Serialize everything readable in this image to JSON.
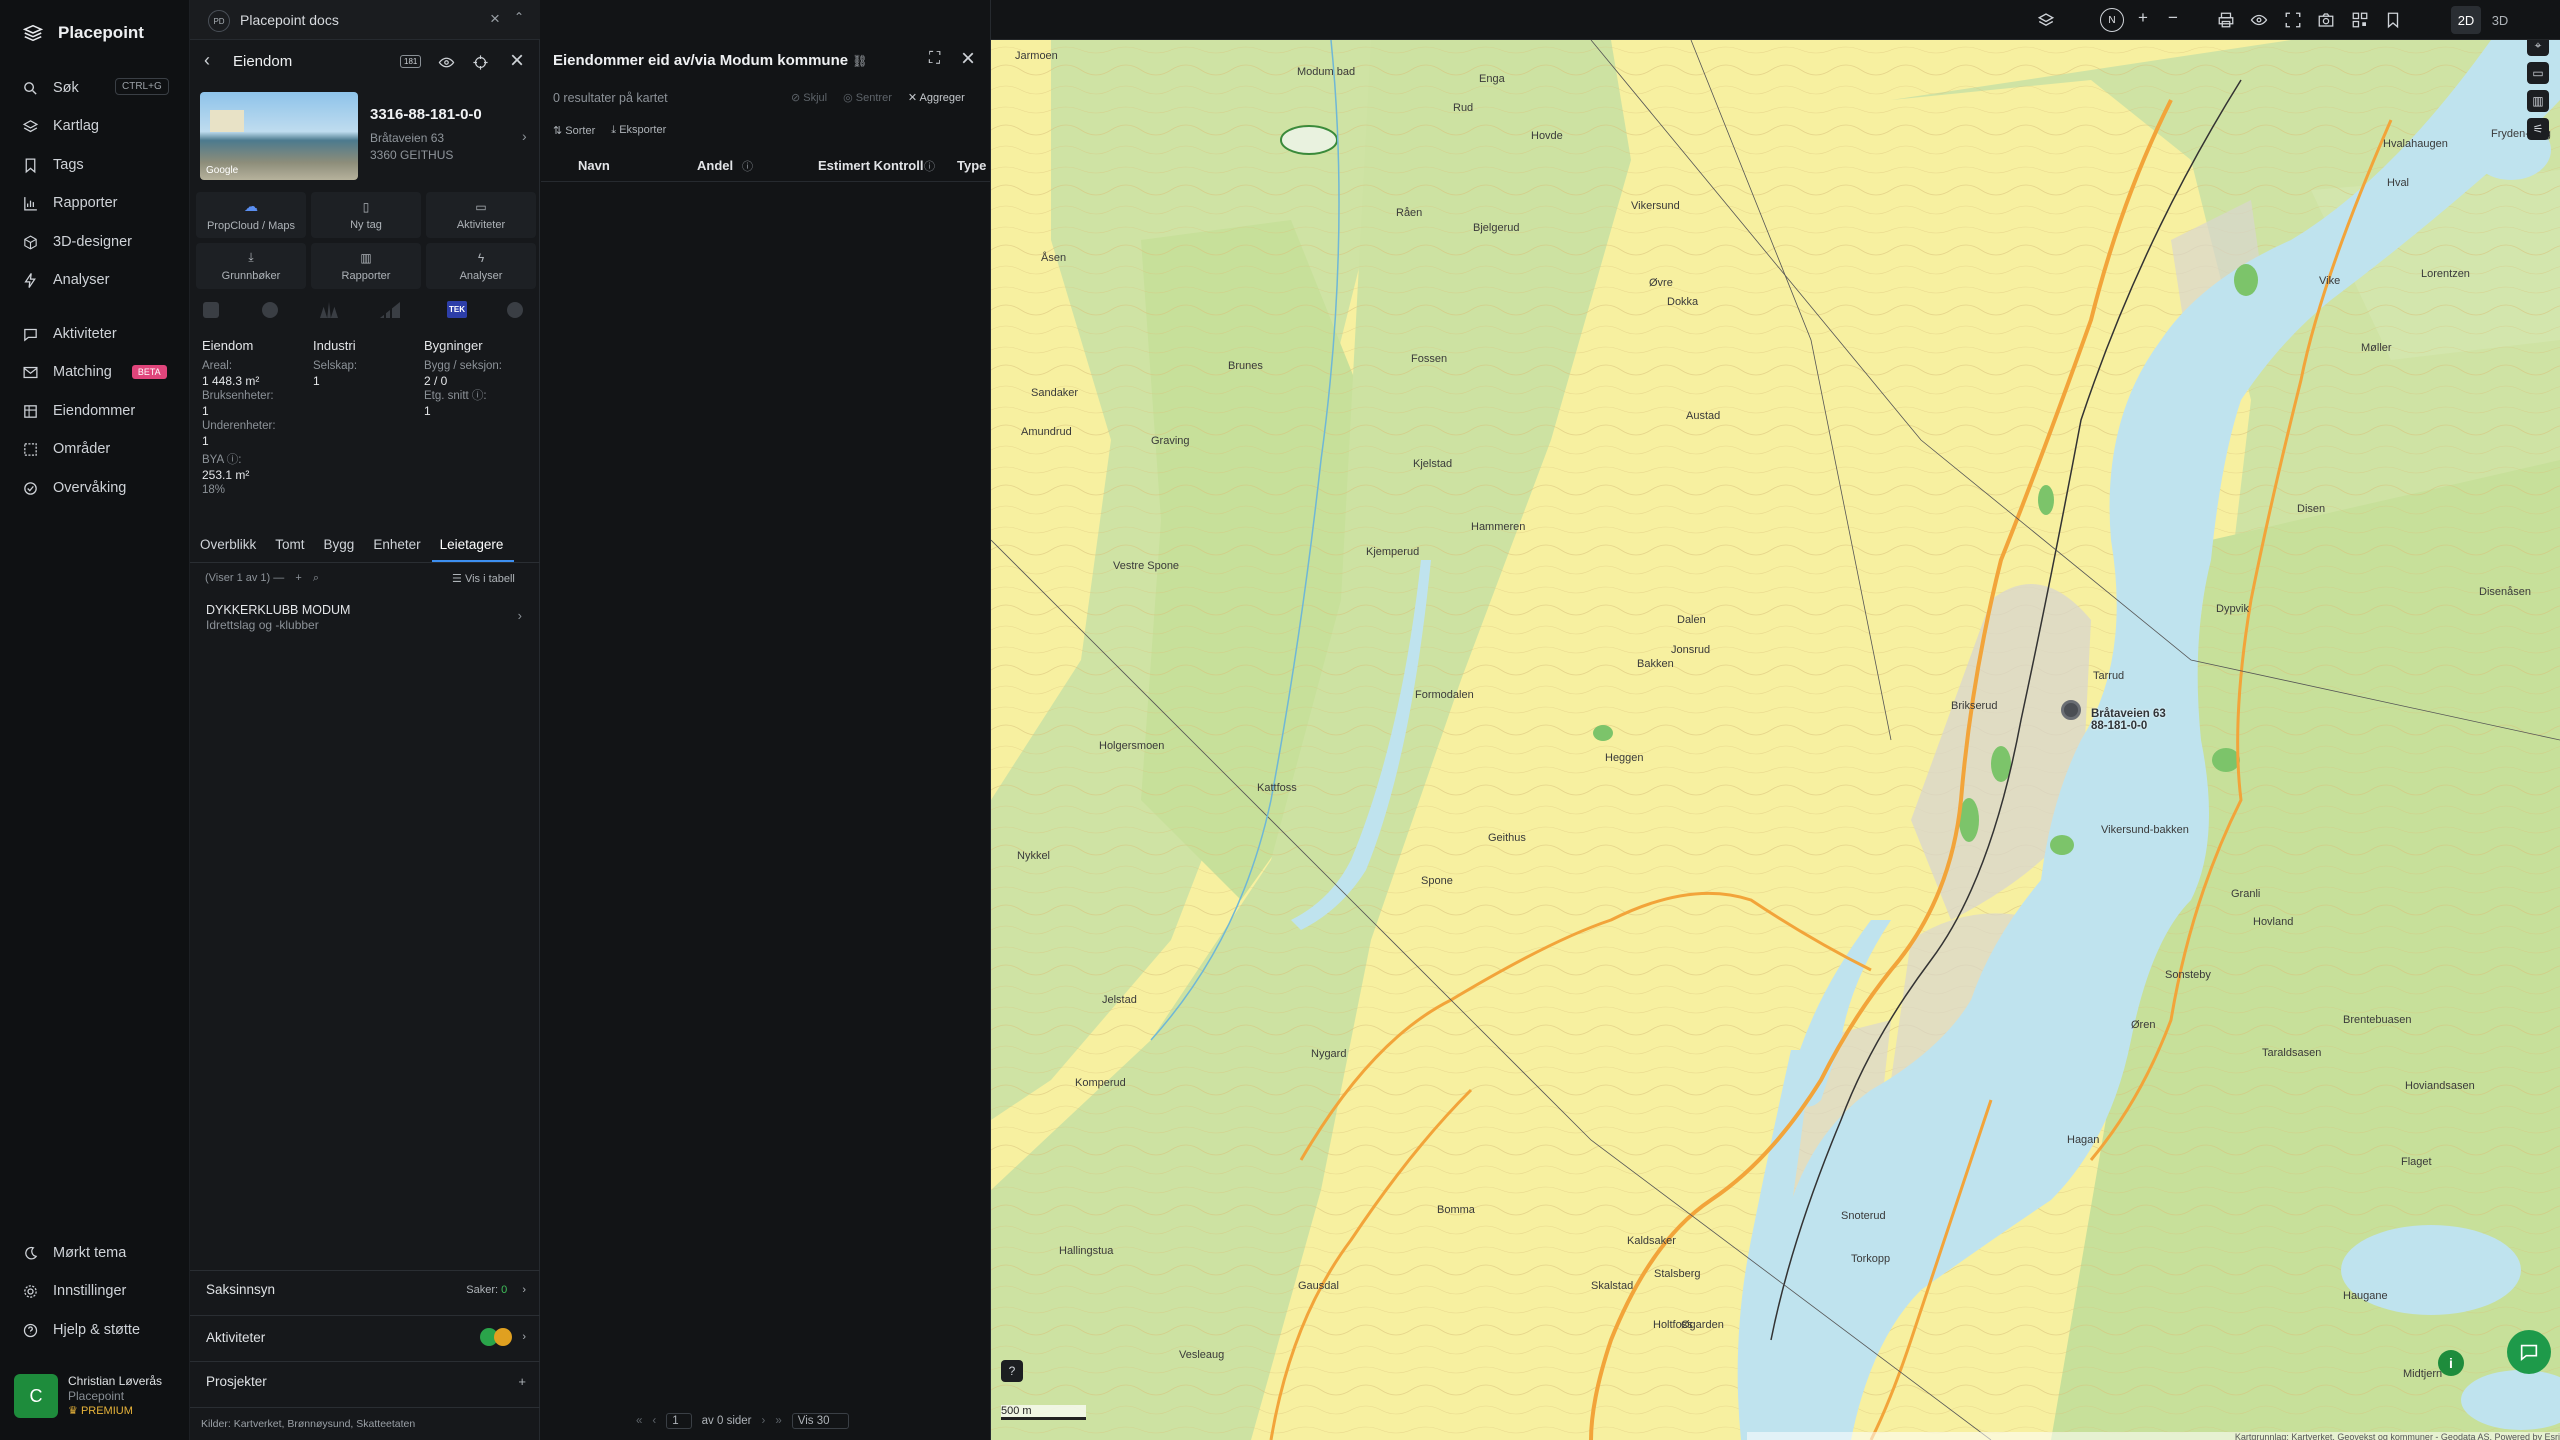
{
  "app": {
    "name": "Placepoint"
  },
  "nav": {
    "search": "Søk",
    "shortcut": "CTRL+G",
    "items": [
      "Kartlag",
      "Tags",
      "Rapporter",
      "3D-designer",
      "Analyser"
    ],
    "items2": [
      "Aktiviteter",
      "Matching",
      "Eiendommer",
      "Områder",
      "Overvåking"
    ],
    "beta": "BETA",
    "bottom": [
      "Mørkt tema",
      "Innstillinger",
      "Hjelp & støtte"
    ],
    "user": {
      "initial": "C",
      "name": "Christian Løverås",
      "org": "Placepoint",
      "plan": "PREMIUM"
    }
  },
  "workspace": {
    "badge": "PD",
    "title": "Placepoint docs"
  },
  "property": {
    "header": "Eiendom",
    "matrikkel": "3316-88-181-0-0",
    "address": "Bråtaveien 63",
    "postal": "3360 GEITHUS",
    "photo_credit": "Google",
    "header_badge": "181",
    "actions": [
      "PropCloud / Maps",
      "Ny tag",
      "Aktiviteter",
      "Grunnbøker",
      "Rapporter",
      "Analyser"
    ],
    "tek_label": "TEK",
    "cols": {
      "eiendom": {
        "title": "Eiendom",
        "areal_label": "Areal:",
        "areal": "1 448.3 m²",
        "bruks_label": "Bruksenheter:",
        "bruks": "1",
        "under_label": "Underenheter:",
        "under": "1",
        "bya_label": "BYA ⓘ:",
        "bya": "253.1 m²",
        "bya_pct": "18%"
      },
      "industri": {
        "title": "Industri",
        "selskap_label": "Selskap:",
        "selskap": "1"
      },
      "bygninger": {
        "title": "Bygninger",
        "bygg_label": "Bygg / seksjon:",
        "bygg": "2 / 0",
        "etg_label": "Etg. snitt ⓘ:",
        "etg": "1"
      }
    },
    "tabs": [
      "Overblikk",
      "Tomt",
      "Bygg",
      "Enheter",
      "Leietagere"
    ],
    "list_info": "(Viser 1 av 1)",
    "table_toggle": "Vis i tabell",
    "tenant": {
      "name": "DYKKERKLUBB MODUM",
      "category": "Idrettslag og -klubber"
    },
    "sections": {
      "saksinnsyn": "Saksinnsyn",
      "saker_label": "Saker:",
      "saker": "0",
      "aktiviteter": "Aktiviteter",
      "prosjekter": "Prosjekter"
    },
    "sources_label": "Kilder:",
    "sources": [
      "Kartverket,",
      "Brønnøysund,",
      "Skatteetaten"
    ]
  },
  "results": {
    "title": "Eiendommer eid av/via Modum kommune",
    "count": "0 resultater på kartet",
    "hide": "Skjul",
    "center": "Sentrer",
    "aggregate": "Aggreger",
    "sort": "Sorter",
    "export": "Eksporter",
    "columns": [
      "Navn",
      "Andel",
      "Estimert Kontroll",
      "Type"
    ],
    "pager": {
      "page": "1",
      "of": "av 0 sider",
      "show": "Vis 30"
    }
  },
  "map": {
    "mode_2d": "2D",
    "mode_3d": "3D",
    "north": "N",
    "marker_line1": "Bråtaveien 63",
    "marker_line2": "88-181-0-0",
    "scale": "500 m",
    "attribution": "Kartgrunnlag: Kartverket, Geovekst og kommuner - Geodata AS, Powered by Esri",
    "places": [
      "Modum bad",
      "Jarmoen",
      "Enga",
      "Rud",
      "Hovde",
      "Bjelgerud",
      "Råen",
      "Fossen",
      "Brunes",
      "Kjelstad",
      "Hammeren",
      "Kjemperud",
      "Vikersund",
      "Øvre",
      "Dokka",
      "Austad",
      "Dalen",
      "Jonsrud",
      "Bakken",
      "Brikserud",
      "Heggen",
      "Spone",
      "Geithus",
      "Kattfoss",
      "Graving",
      "Åsen",
      "Sandaker",
      "Amundrud",
      "Vestre Spone",
      "Formodalen",
      "Holgersmoen",
      "Nykkel",
      "Jelstad",
      "Komperud",
      "Nygard",
      "Hallingstua",
      "Vesleaug",
      "Gausdal",
      "Skalstad",
      "Holtfoss",
      "Bomma",
      "Kaldsaker",
      "Stalsberg",
      "Øgarden",
      "Snoterud",
      "Torkopp",
      "Hagan",
      "Sonsteby",
      "Øren",
      "Granli",
      "Hovland",
      "Taraldsasen",
      "Hoviandsasen",
      "Brentebuasen",
      "Flaget",
      "Haugane",
      "Midtjern",
      "Disenåsen",
      "Disen",
      "Dypvik",
      "Møller",
      "Lorentzen",
      "Fryden-berg",
      "Hvalahaugen",
      "Hval",
      "Vike",
      "Vikersund-bakken",
      "Tarrud"
    ]
  }
}
